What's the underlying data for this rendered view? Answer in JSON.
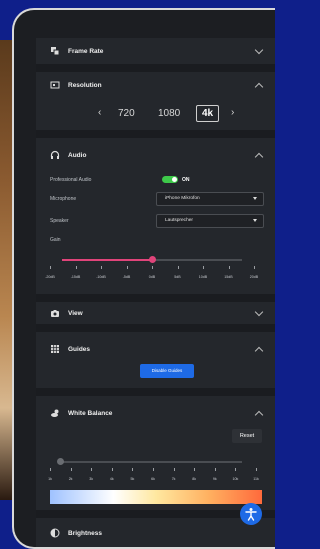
{
  "sections": {
    "frame_rate": {
      "title": "Frame Rate"
    },
    "resolution": {
      "title": "Resolution",
      "options": [
        "720",
        "1080",
        "4k"
      ],
      "selected": "4k"
    },
    "audio": {
      "title": "Audio",
      "professional_audio_label": "Professional Audio",
      "professional_audio_state": "ON",
      "microphone_label": "Microphone",
      "microphone_value": "iPhone Mikrofon",
      "speaker_label": "Speaker",
      "speaker_value": "Lautsprecher",
      "gain_label": "Gain",
      "gain_ticks": [
        "-20dB",
        "-15dB",
        "-10dB",
        "-5dB",
        "0dB",
        "5dB",
        "10dB",
        "15dB",
        "20dB"
      ],
      "gain_value": "0dB"
    },
    "view": {
      "title": "View"
    },
    "guides": {
      "title": "Guides",
      "button_label": "Disable Guides"
    },
    "white_balance": {
      "title": "White Balance",
      "reset_label": "Reset",
      "ticks": [
        "1k",
        "2k",
        "3k",
        "4k",
        "5k",
        "6k",
        "7k",
        "8k",
        "9k",
        "10k",
        "11k"
      ],
      "value": "1k"
    },
    "brightness": {
      "title": "Brightness"
    }
  },
  "colors": {
    "accent": "#e0447a",
    "toggle_on": "#3ec94a",
    "primary_button": "#1e6ae6",
    "background": "#0f1f8a"
  },
  "icons": {
    "frame_rate": "film-icon",
    "resolution": "screen-icon",
    "audio": "headphones-icon",
    "view": "camera-icon",
    "guides": "grid-icon",
    "white_balance": "cloud-sun-icon",
    "brightness": "contrast-icon",
    "accessibility": "accessibility-icon"
  }
}
